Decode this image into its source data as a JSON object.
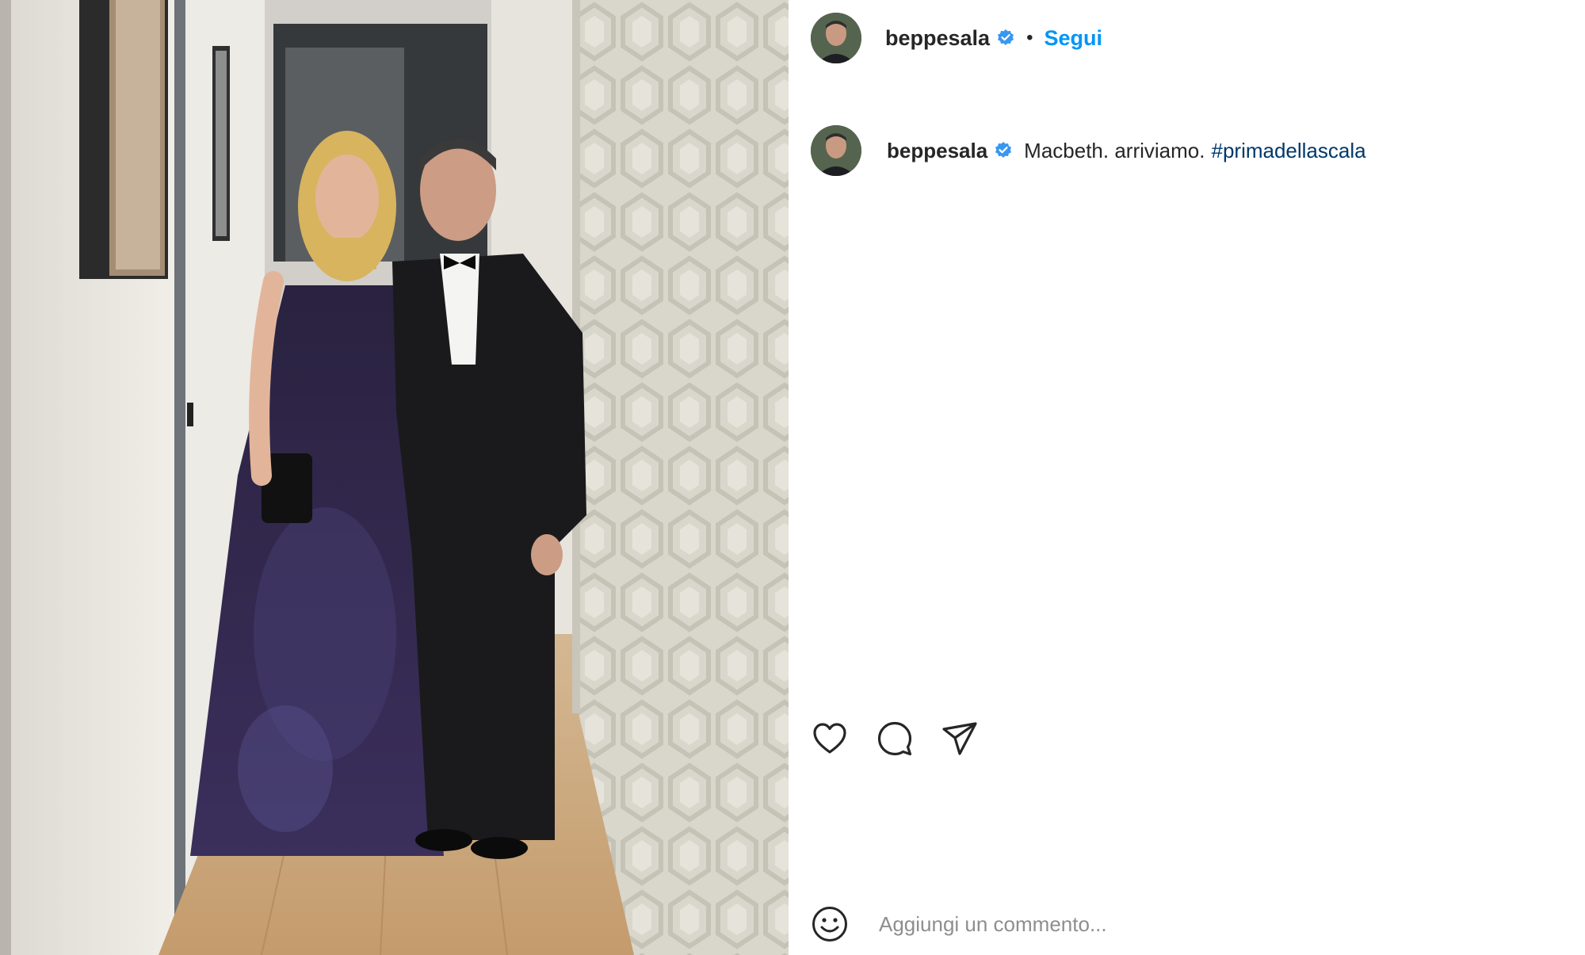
{
  "post": {
    "author": {
      "username": "beppesala",
      "verified": true,
      "follow_label": "Segui",
      "separator": "•"
    },
    "caption": {
      "username": "beppesala",
      "text": "Macbeth. arriviamo.",
      "hashtag": "#primadellascala"
    },
    "actions": {
      "like_icon": "heart-icon",
      "comment_icon": "comment-icon",
      "share_icon": "paper-plane-icon"
    },
    "comment_box": {
      "emoji_icon": "smiley-icon",
      "placeholder": "Aggiungi un commento..."
    },
    "colors": {
      "accent": "#0095f6",
      "hashtag": "#00376b",
      "verified": "#3897f0",
      "text": "#262626",
      "muted": "#8e8e8e"
    }
  }
}
